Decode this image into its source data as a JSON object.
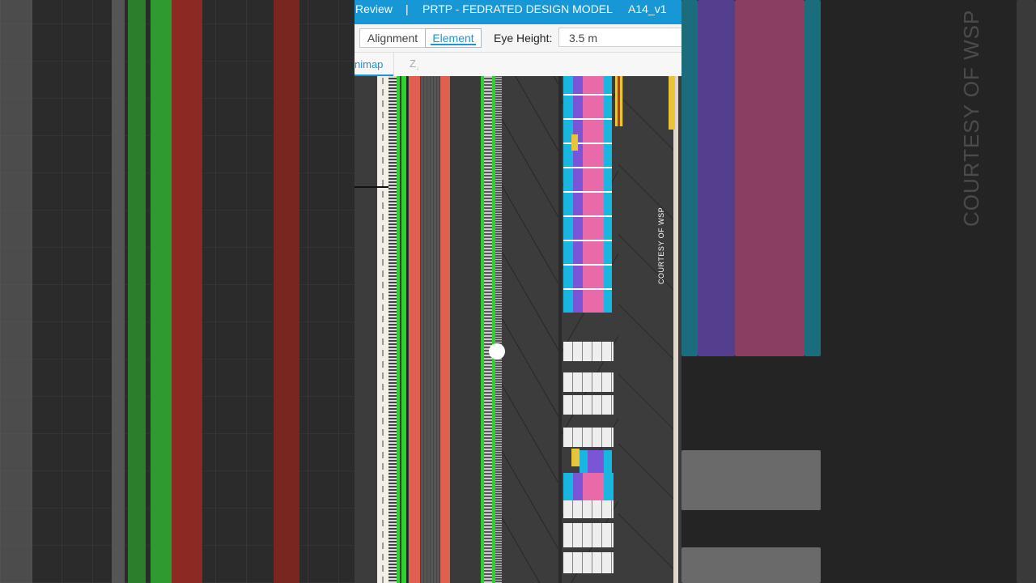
{
  "header": {
    "review": "Review",
    "separator": "|",
    "project": "PRTP - FEDRATED DESIGN MODEL",
    "version": "A14_v1"
  },
  "toolbar": {
    "alignment_label": "Alignment",
    "element_label": "Element",
    "eye_height_label": "Eye Height:",
    "eye_height_value": "3.5 m"
  },
  "tabs": {
    "minimap": "nimap",
    "z_icon": "Z"
  },
  "watermark": "COURTESY OF WSP",
  "colors": {
    "accent": "#1797d6",
    "rail_green": "#2ed12e",
    "rail_red": "#e0604f",
    "container_cyan": "#19b6e0",
    "container_purple": "#7a55d8",
    "container_pink": "#e86aa8",
    "container_white": "#eeeeee",
    "container_yellow": "#e8c43a"
  },
  "icons": [
    "z-sort-icon",
    "scroll-handle-icon"
  ]
}
